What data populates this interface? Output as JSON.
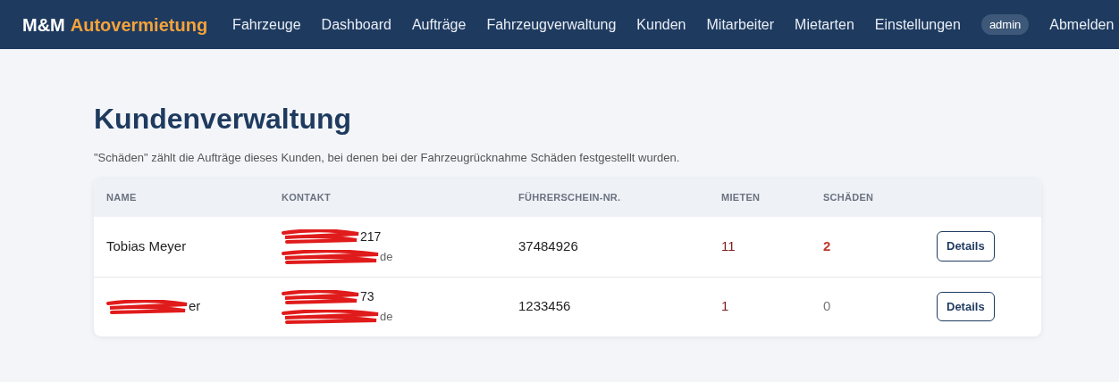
{
  "navbar": {
    "brand": {
      "part_1": "M&M",
      "part_2": "Autovermietung"
    },
    "links": [
      "Fahrzeuge",
      "Dashboard",
      "Aufträge",
      "Fahrzeugverwaltung",
      "Kunden",
      "Mitarbeiter",
      "Mietarten",
      "Einstellungen"
    ],
    "user_badge": "admin",
    "logout": "Abmelden"
  },
  "page": {
    "title": "Kundenverwaltung",
    "note": "\"Schäden\" zählt die Aufträge dieses Kunden, bei denen bei der Fahrzeugrücknahme Schäden festgestellt wurden."
  },
  "table": {
    "columns": [
      "NAME",
      "KONTAKT",
      "FÜHRERSCHEIN-NR.",
      "MIETEN",
      "SCHÄDEN"
    ],
    "rows": [
      {
        "name": {
          "text": "Tobias Meyer",
          "redacted": false
        },
        "phone": {
          "text": "217",
          "redacted": true
        },
        "email": {
          "text": "de",
          "redacted": true
        },
        "license": "37484926",
        "rentals": "11",
        "damages": "2",
        "flagged": true,
        "action": "Details"
      },
      {
        "name": {
          "text": "er",
          "redacted": true
        },
        "phone": {
          "text": "73",
          "redacted": true
        },
        "email": {
          "text": "de",
          "redacted": true
        },
        "license": "1233456",
        "rentals": "1",
        "damages": "0",
        "flagged": false,
        "action": "Details"
      }
    ]
  }
}
